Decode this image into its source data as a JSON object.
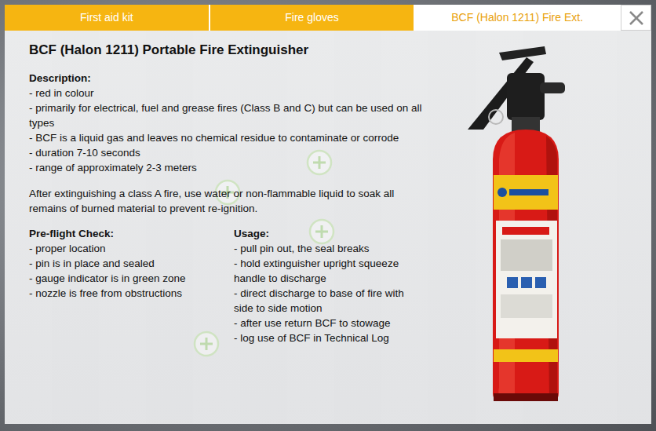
{
  "tabs": [
    {
      "label": "First aid kit",
      "selected": false
    },
    {
      "label": "Fire gloves",
      "selected": false
    },
    {
      "label": "BCF (Halon 1211) Fire Ext.",
      "selected": true
    }
  ],
  "title": "BCF (Halon 1211) Portable Fire Extinguisher",
  "description": {
    "heading": "Description:",
    "items": [
      "- red in colour",
      "- primarily for electrical, fuel and grease fires (Class B and C) but can be used on all types",
      "- BCF is a liquid gas and leaves no chemical residue to contaminate or corrode",
      "- duration 7-10 seconds",
      "- range of approximately 2-3 meters"
    ]
  },
  "note": "After extinguishing a class A fire, use water or non-flammable liquid to soak all remains of burned material to prevent re-ignition.",
  "preflight": {
    "heading": "Pre-flight Check:",
    "items": [
      "- proper location",
      "- pin is in place and sealed",
      "- gauge indicator is in green zone",
      "- nozzle is free from obstructions"
    ]
  },
  "usage": {
    "heading": "Usage:",
    "items": [
      "- pull pin out, the seal breaks",
      "- hold extinguisher upright squeeze handle to discharge",
      "- direct discharge to base of fire with side to side motion",
      "- after use return BCF to stowage",
      "- log use of BCF in Technical Log"
    ]
  }
}
